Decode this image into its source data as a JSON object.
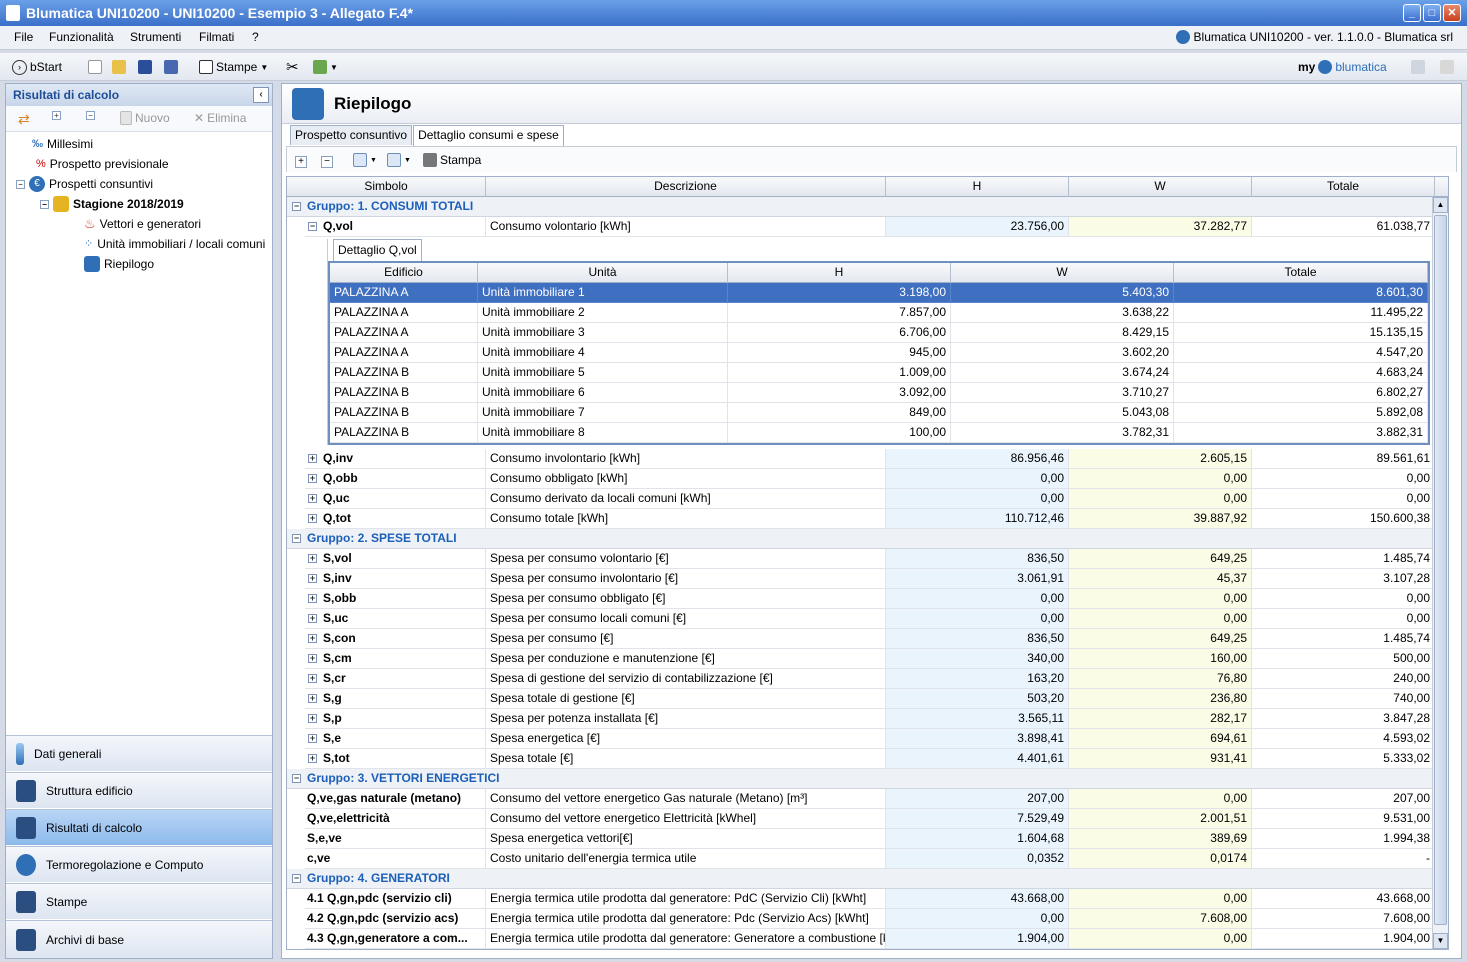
{
  "window": {
    "title": "Blumatica UNI10200 - UNI10200 - Esempio 3 - Allegato F.4*"
  },
  "menu": {
    "items": [
      "File",
      "Funzionalità",
      "Strumenti",
      "Filmati",
      "?"
    ],
    "version_info": "Blumatica UNI10200 - ver. 1.1.0.0 - Blumatica srl"
  },
  "toolbar": {
    "bstart": "bStart",
    "stampe": "Stampe",
    "brand_my": "my",
    "brand_name": "blumatica"
  },
  "sidebar": {
    "title": "Risultati di calcolo",
    "tools": {
      "nuovo": "Nuovo",
      "elimina": "Elimina"
    },
    "tree": [
      "Millesimi",
      "Prospetto previsionale",
      "Prospetti consuntivi",
      "Stagione 2018/2019",
      "Vettori e generatori",
      "Unità immobiliari / locali comuni",
      "Riepilogo"
    ],
    "nav": [
      "Dati generali",
      "Struttura edificio",
      "Risultati di calcolo",
      "Termoregolazione e Computo",
      "Stampe",
      "Archivi di base"
    ]
  },
  "main": {
    "title": "Riepilogo",
    "tabs": [
      "Prospetto consuntivo",
      "Dettaglio consumi e spese"
    ],
    "print_label": "Stampa",
    "columns": [
      "Simbolo",
      "Descrizione",
      "H",
      "W",
      "Totale"
    ],
    "groups": [
      {
        "label": "Gruppo: 1. CONSUMI TOTALI"
      },
      {
        "label": "Gruppo: 2. SPESE TOTALI"
      },
      {
        "label": "Gruppo: 3. VETTORI ENERGETICI"
      },
      {
        "label": "Gruppo: 4. GENERATORI"
      }
    ],
    "qvol": {
      "sym": "Q,vol",
      "desc": "Consumo volontario [kWh]",
      "h": "23.756,00",
      "w": "37.282,77",
      "tot": "61.038,77"
    },
    "detail": {
      "tab": "Dettaglio Q,vol",
      "columns": [
        "Edificio",
        "Unità",
        "H",
        "W",
        "Totale"
      ],
      "rows": [
        [
          "PALAZZINA A",
          "Unità immobiliare 1",
          "3.198,00",
          "5.403,30",
          "8.601,30"
        ],
        [
          "PALAZZINA A",
          "Unità immobiliare 2",
          "7.857,00",
          "3.638,22",
          "11.495,22"
        ],
        [
          "PALAZZINA A",
          "Unità immobiliare 3",
          "6.706,00",
          "8.429,15",
          "15.135,15"
        ],
        [
          "PALAZZINA A",
          "Unità immobiliare 4",
          "945,00",
          "3.602,20",
          "4.547,20"
        ],
        [
          "PALAZZINA B",
          "Unità immobiliare 5",
          "1.009,00",
          "3.674,24",
          "4.683,24"
        ],
        [
          "PALAZZINA B",
          "Unità immobiliare 6",
          "3.092,00",
          "3.710,27",
          "6.802,27"
        ],
        [
          "PALAZZINA B",
          "Unità immobiliare 7",
          "849,00",
          "5.043,08",
          "5.892,08"
        ],
        [
          "PALAZZINA B",
          "Unità immobiliare 8",
          "100,00",
          "3.782,31",
          "3.882,31"
        ]
      ]
    },
    "group1_rest": [
      [
        "Q,inv",
        "Consumo involontario [kWh]",
        "86.956,46",
        "2.605,15",
        "89.561,61"
      ],
      [
        "Q,obb",
        "Consumo obbligato [kWh]",
        "0,00",
        "0,00",
        "0,00"
      ],
      [
        "Q,uc",
        "Consumo derivato da locali comuni [kWh]",
        "0,00",
        "0,00",
        "0,00"
      ],
      [
        "Q,tot",
        "Consumo totale [kWh]",
        "110.712,46",
        "39.887,92",
        "150.600,38"
      ]
    ],
    "group2": [
      [
        "S,vol",
        "Spesa per consumo volontario [€]",
        "836,50",
        "649,25",
        "1.485,74"
      ],
      [
        "S,inv",
        "Spesa per consumo involontario [€]",
        "3.061,91",
        "45,37",
        "3.107,28"
      ],
      [
        "S,obb",
        "Spesa per consumo obbligato [€]",
        "0,00",
        "0,00",
        "0,00"
      ],
      [
        "S,uc",
        "Spesa per consumo locali comuni [€]",
        "0,00",
        "0,00",
        "0,00"
      ],
      [
        "S,con",
        "Spesa per consumo [€]",
        "836,50",
        "649,25",
        "1.485,74"
      ],
      [
        "S,cm",
        "Spesa per conduzione e manutenzione [€]",
        "340,00",
        "160,00",
        "500,00"
      ],
      [
        "S,cr",
        "Spesa di gestione del servizio di contabilizzazione [€]",
        "163,20",
        "76,80",
        "240,00"
      ],
      [
        "S,g",
        "Spesa totale di gestione [€]",
        "503,20",
        "236,80",
        "740,00"
      ],
      [
        "S,p",
        "Spesa per potenza installata [€]",
        "3.565,11",
        "282,17",
        "3.847,28"
      ],
      [
        "S,e",
        "Spesa energetica [€]",
        "3.898,41",
        "694,61",
        "4.593,02"
      ],
      [
        "S,tot",
        "Spesa totale [€]",
        "4.401,61",
        "931,41",
        "5.333,02"
      ]
    ],
    "group3": [
      [
        "Q,ve,gas naturale (metano)",
        "Consumo del vettore energetico Gas naturale (Metano) [m³]",
        "207,00",
        "0,00",
        "207,00"
      ],
      [
        "Q,ve,elettricità",
        "Consumo del vettore energetico Elettricità [kWhel]",
        "7.529,49",
        "2.001,51",
        "9.531,00"
      ],
      [
        "S,e,ve",
        "Spesa energetica vettori[€]",
        "1.604,68",
        "389,69",
        "1.994,38"
      ],
      [
        "c,ve",
        "Costo unitario dell'energia termica utile",
        "0,0352",
        "0,0174",
        "-"
      ]
    ],
    "group4": [
      [
        "4.1 Q,gn,pdc (servizio cli)",
        "Energia termica utile prodotta dal generatore: PdC (Servizio Cli) [kWht]",
        "43.668,00",
        "0,00",
        "43.668,00"
      ],
      [
        "4.2 Q,gn,pdc (servizio acs)",
        "Energia termica utile prodotta dal generatore: Pdc (Servizio Acs) [kWht]",
        "0,00",
        "7.608,00",
        "7.608,00"
      ],
      [
        "4.3 Q,gn,generatore a com...",
        "Energia termica utile prodotta dal generatore: Generatore a combustione [kWht]",
        "1.904,00",
        "0,00",
        "1.904,00"
      ]
    ]
  }
}
